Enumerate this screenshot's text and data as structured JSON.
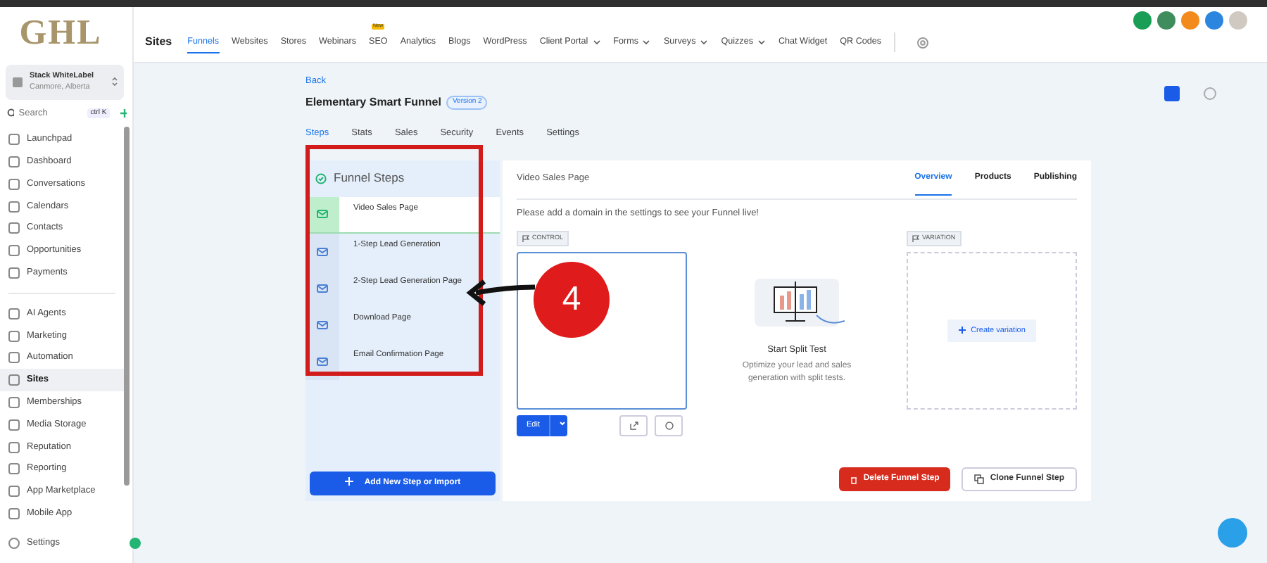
{
  "logo": "GHL",
  "account": {
    "name": "Stack WhiteLabel",
    "location": "Canmore, Alberta"
  },
  "search": {
    "placeholder": "Search",
    "shortcut": "ctrl K"
  },
  "sidebar": {
    "sections": [
      [
        {
          "label": "Launchpad",
          "selected": false
        },
        {
          "label": "Dashboard",
          "selected": false
        },
        {
          "label": "Conversations",
          "selected": false
        },
        {
          "label": "Calendars",
          "selected": false
        },
        {
          "label": "Contacts",
          "selected": false
        },
        {
          "label": "Opportunities",
          "selected": false
        },
        {
          "label": "Payments",
          "selected": false
        }
      ],
      [
        {
          "label": "AI Agents",
          "selected": false
        },
        {
          "label": "Marketing",
          "selected": false
        },
        {
          "label": "Automation",
          "selected": false
        },
        {
          "label": "Sites",
          "selected": true
        },
        {
          "label": "Memberships",
          "selected": false
        },
        {
          "label": "Media Storage",
          "selected": false
        },
        {
          "label": "Reputation",
          "selected": false
        },
        {
          "label": "Reporting",
          "selected": false
        },
        {
          "label": "App Marketplace",
          "selected": false
        },
        {
          "label": "Mobile App",
          "selected": false
        }
      ]
    ],
    "footer_item": "Settings"
  },
  "topnav": {
    "title": "Sites",
    "tabs": [
      {
        "label": "Funnels",
        "selected": true,
        "dropdown": false
      },
      {
        "label": "Websites",
        "selected": false,
        "dropdown": false
      },
      {
        "label": "Stores",
        "selected": false,
        "dropdown": false
      },
      {
        "label": "Webinars",
        "selected": false,
        "dropdown": false
      },
      {
        "label": "SEO",
        "selected": false,
        "dropdown": false,
        "badge": "New"
      },
      {
        "label": "Analytics",
        "selected": false,
        "dropdown": false
      },
      {
        "label": "Blogs",
        "selected": false,
        "dropdown": false
      },
      {
        "label": "WordPress",
        "selected": false,
        "dropdown": false
      },
      {
        "label": "Client Portal",
        "selected": false,
        "dropdown": true
      },
      {
        "label": "Forms",
        "selected": false,
        "dropdown": true
      },
      {
        "label": "Surveys",
        "selected": false,
        "dropdown": true
      },
      {
        "label": "Quizzes",
        "selected": false,
        "dropdown": true
      },
      {
        "label": "Chat Widget",
        "selected": false,
        "dropdown": false
      },
      {
        "label": "QR Codes",
        "selected": false,
        "dropdown": false
      }
    ]
  },
  "funnel": {
    "back": "Back",
    "title": "Elementary Smart Funnel",
    "version": "Version 2",
    "tabs": [
      {
        "label": "Steps",
        "selected": true
      },
      {
        "label": "Stats",
        "selected": false
      },
      {
        "label": "Sales",
        "selected": false
      },
      {
        "label": "Security",
        "selected": false
      },
      {
        "label": "Events",
        "selected": false
      },
      {
        "label": "Settings",
        "selected": false
      }
    ]
  },
  "steps": {
    "title": "Funnel Steps",
    "items": [
      {
        "label": "Video Sales Page",
        "selected": true
      },
      {
        "label": "1-Step Lead Generation",
        "selected": false
      },
      {
        "label": "2-Step Lead Generation Page",
        "selected": false
      },
      {
        "label": "Download Page",
        "selected": false
      },
      {
        "label": "Email Confirmation Page",
        "selected": false
      }
    ],
    "add_button": "Add New Step or Import"
  },
  "step_detail": {
    "title": "Video Sales Page",
    "tabs": [
      {
        "label": "Overview",
        "selected": true
      },
      {
        "label": "Products",
        "selected": false
      },
      {
        "label": "Publishing",
        "selected": false
      }
    ],
    "notice": "Please add a domain in the settings to see your Funnel live!",
    "control_label": "CONTROL",
    "edit_button": "Edit",
    "split_title": "Start Split Test",
    "split_text": "Optimize your lead and sales generation with split tests.",
    "variation_label": "VARIATION",
    "create_button": "Create variation",
    "delete_button": "Delete Funnel Step",
    "clone_button": "Clone Funnel Step"
  },
  "annotation": {
    "number": "4"
  }
}
